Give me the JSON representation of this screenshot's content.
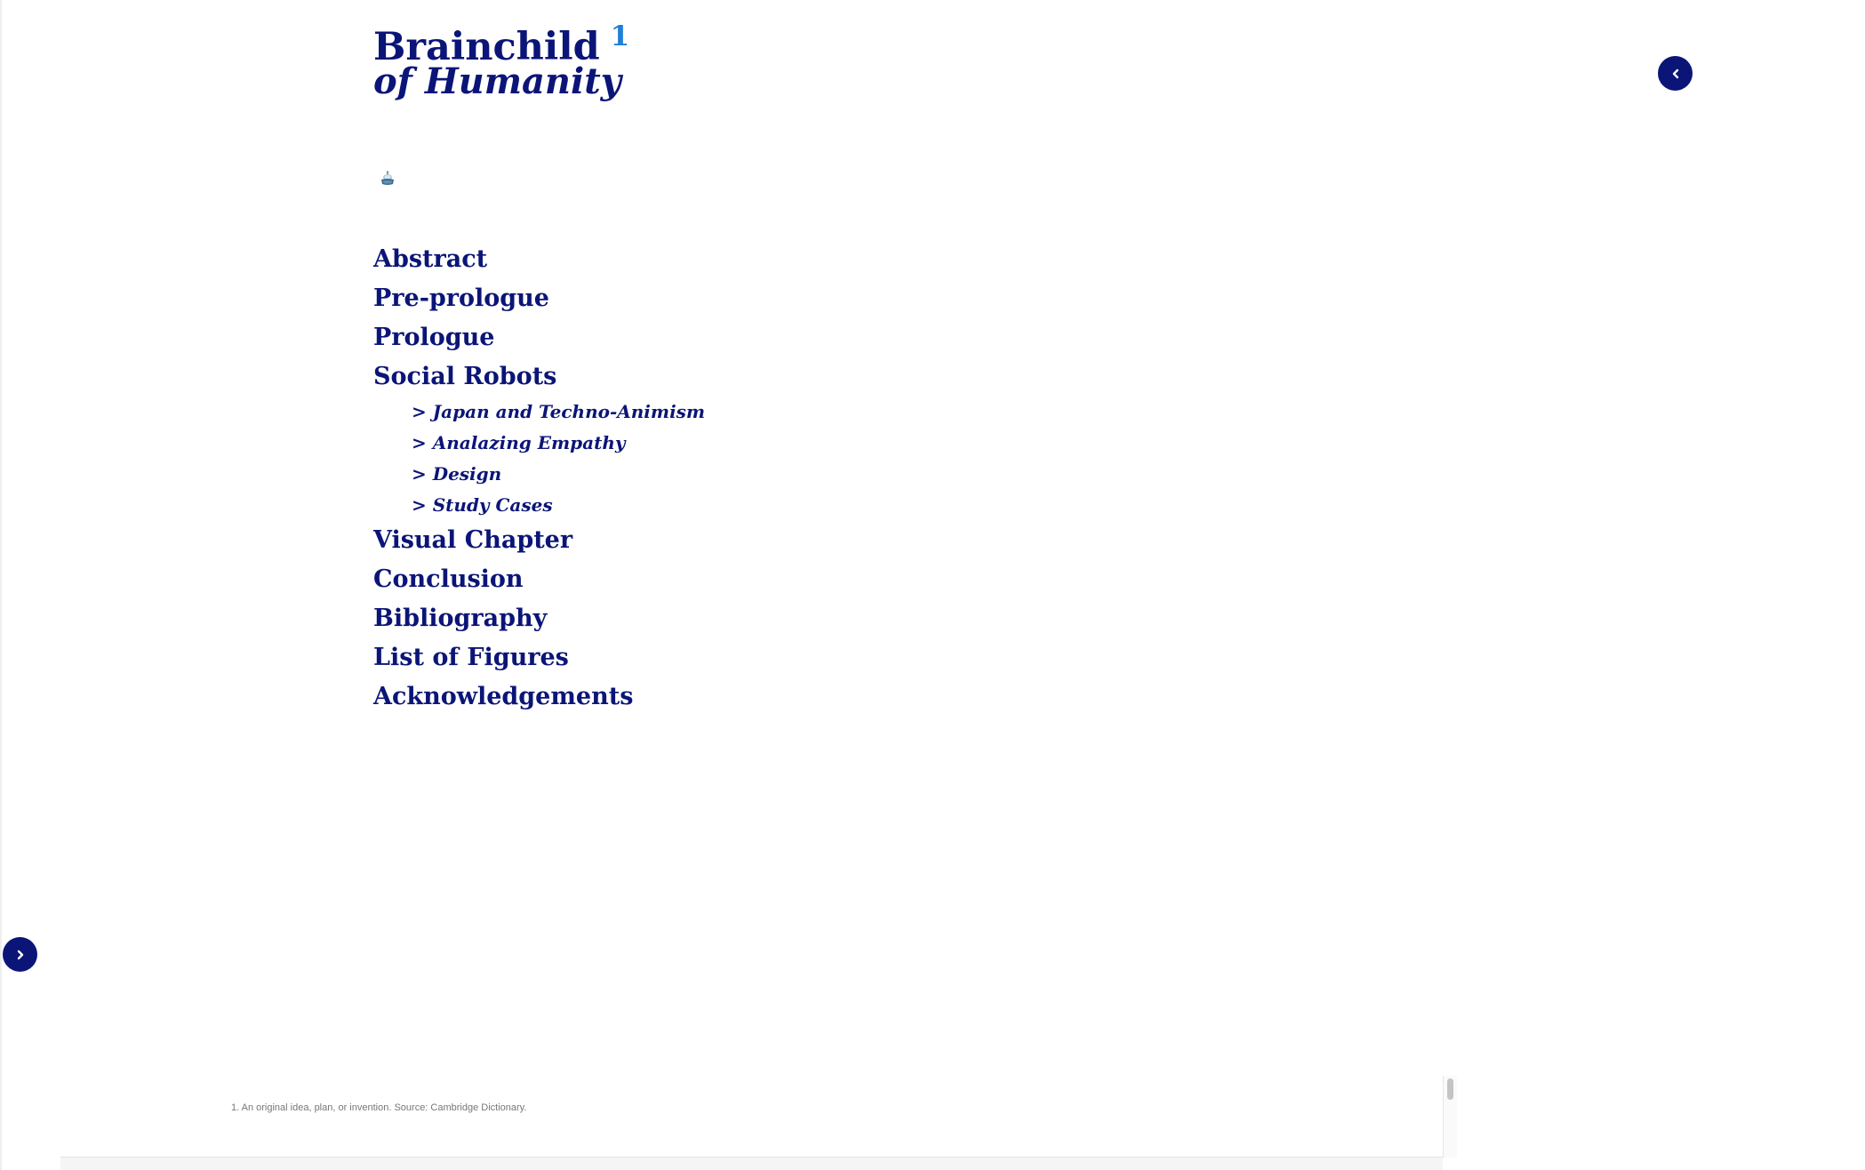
{
  "header": {
    "title_line1": "Brainchild",
    "title_sup": "1",
    "title_line2": "of Humanity"
  },
  "icons": {
    "mascot": "robot-mascot-icon",
    "collapse": "chevron-left-icon",
    "expand": "chevron-right-icon"
  },
  "toc": {
    "items": [
      {
        "label": "Abstract"
      },
      {
        "label": "Pre-prologue"
      },
      {
        "label": "Prologue"
      },
      {
        "label": "Social Robots"
      },
      {
        "label": "Visual Chapter"
      },
      {
        "label": "Conclusion"
      },
      {
        "label": "Bibliography"
      },
      {
        "label": "List of Figures"
      },
      {
        "label": "Acknowledgements"
      }
    ],
    "social_robots_sub": [
      {
        "label": "> Japan and Techno-Animism"
      },
      {
        "label": "> Analazing Empathy"
      },
      {
        "label": "> Design"
      },
      {
        "label": "> Study Cases"
      }
    ]
  },
  "footnote": {
    "text": "1. An original idea, plan, or invention. Source: Cambridge Dictionary."
  },
  "colors": {
    "primary": "#0b1577",
    "accent": "#1f7fd9",
    "background": "#ffffff",
    "footnote_text": "#777777"
  }
}
